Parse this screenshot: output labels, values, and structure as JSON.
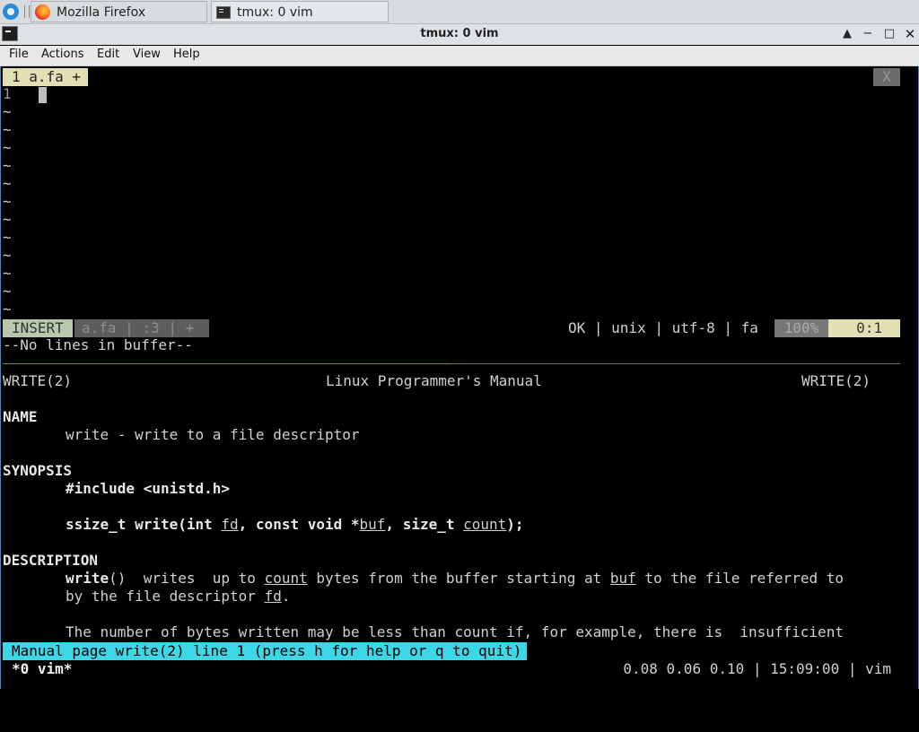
{
  "taskbar": {
    "tasks": [
      {
        "label": "Mozilla Firefox",
        "icon": "firefox-icon"
      },
      {
        "label": "tmux: 0 vim",
        "icon": "terminal-icon"
      }
    ]
  },
  "window": {
    "title": "tmux: 0 vim",
    "controls": [
      "▲",
      "−",
      "□",
      "✕"
    ]
  },
  "menubar": {
    "items": [
      "File",
      "Actions",
      "Edit",
      "View",
      "Help"
    ]
  },
  "vim": {
    "tab_label": "1 a.fa +",
    "tab_close": "X",
    "line_number": "1",
    "tilde": "~",
    "status": {
      "mode": "INSERT",
      "file_info": "a.fa | :3 | +",
      "right_info": "OK | unix | utf-8 | fa",
      "percent": "100%",
      "position": "0:1"
    },
    "message": "--No lines in buffer--"
  },
  "manpage": {
    "header_left": "WRITE(2)",
    "header_center": "Linux Programmer's Manual",
    "header_right": "WRITE(2)",
    "name_heading": "NAME",
    "name_text": "write - write to a file descriptor",
    "synopsis_heading": "SYNOPSIS",
    "include": "#include <unistd.h>",
    "sig_prefix": "ssize_t write(int ",
    "sig_fd": "fd",
    "sig_mid1": ", const void *",
    "sig_buf": "buf",
    "sig_mid2": ", size_t ",
    "sig_count": "count",
    "sig_end": ");",
    "description_heading": "DESCRIPTION",
    "desc1_fn": "write",
    "desc1_a": "()  writes  up to ",
    "desc1_count": "count",
    "desc1_b": " bytes from the buffer starting at ",
    "desc1_buf": "buf",
    "desc1_c": " to the file referred to",
    "desc2_a": "by the file descriptor ",
    "desc2_fd": "fd",
    "desc2_b": ".",
    "desc3": "The number of bytes written may be less than count if, for example, there is  insufficient",
    "status_line": "Manual page write(2) line 1 (press h for help or q to quit)"
  },
  "tmux": {
    "left": "*0 vim*",
    "right": "0.08 0.06 0.10 | 15:09:00 | vim"
  }
}
